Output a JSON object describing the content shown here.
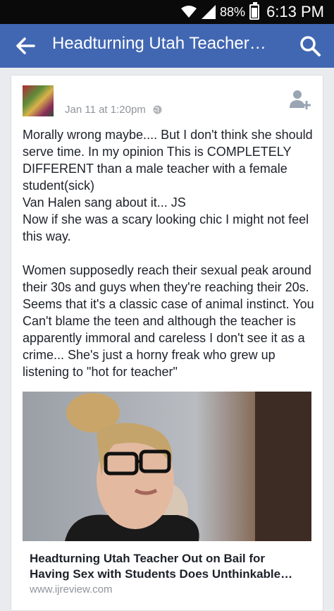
{
  "status": {
    "battery": "88%",
    "time": "6:13 PM"
  },
  "appbar": {
    "title": "Headturning Utah Teacher…"
  },
  "post": {
    "date": "Jan 11 at 1:20pm",
    "text": "Morally wrong maybe.... But I don't think she should serve time. In my opinion This is COMPLETELY DIFFERENT than a male teacher with a female student(sick)\nVan Halen sang about it... JS\nNow if she was a scary looking chic I might not feel this way.\n\nWomen supposedly reach their sexual peak around their 30s and guys when they're reaching their 20s. Seems that it's a classic case of animal instinct.  You Can't blame the teen and although the teacher is apparently immoral and careless I don't see it as a crime... She's just a horny freak who grew up listening to \"hot for teacher\""
  },
  "link": {
    "title": "Headturning Utah Teacher Out on Bail for Having Sex with Students Does Unthinkable…",
    "domain": "www.ijreview.com"
  },
  "icons": {
    "back": "arrow-back-icon",
    "search": "search-icon",
    "wifi": "wifi-icon",
    "signal": "signal-icon",
    "battery": "battery-icon",
    "privacy": "globe-icon",
    "add_friend": "add-friend-icon"
  },
  "colors": {
    "appbar": "#4267b2",
    "statusbar": "#0a0a0a",
    "meta_text": "#90949c"
  }
}
